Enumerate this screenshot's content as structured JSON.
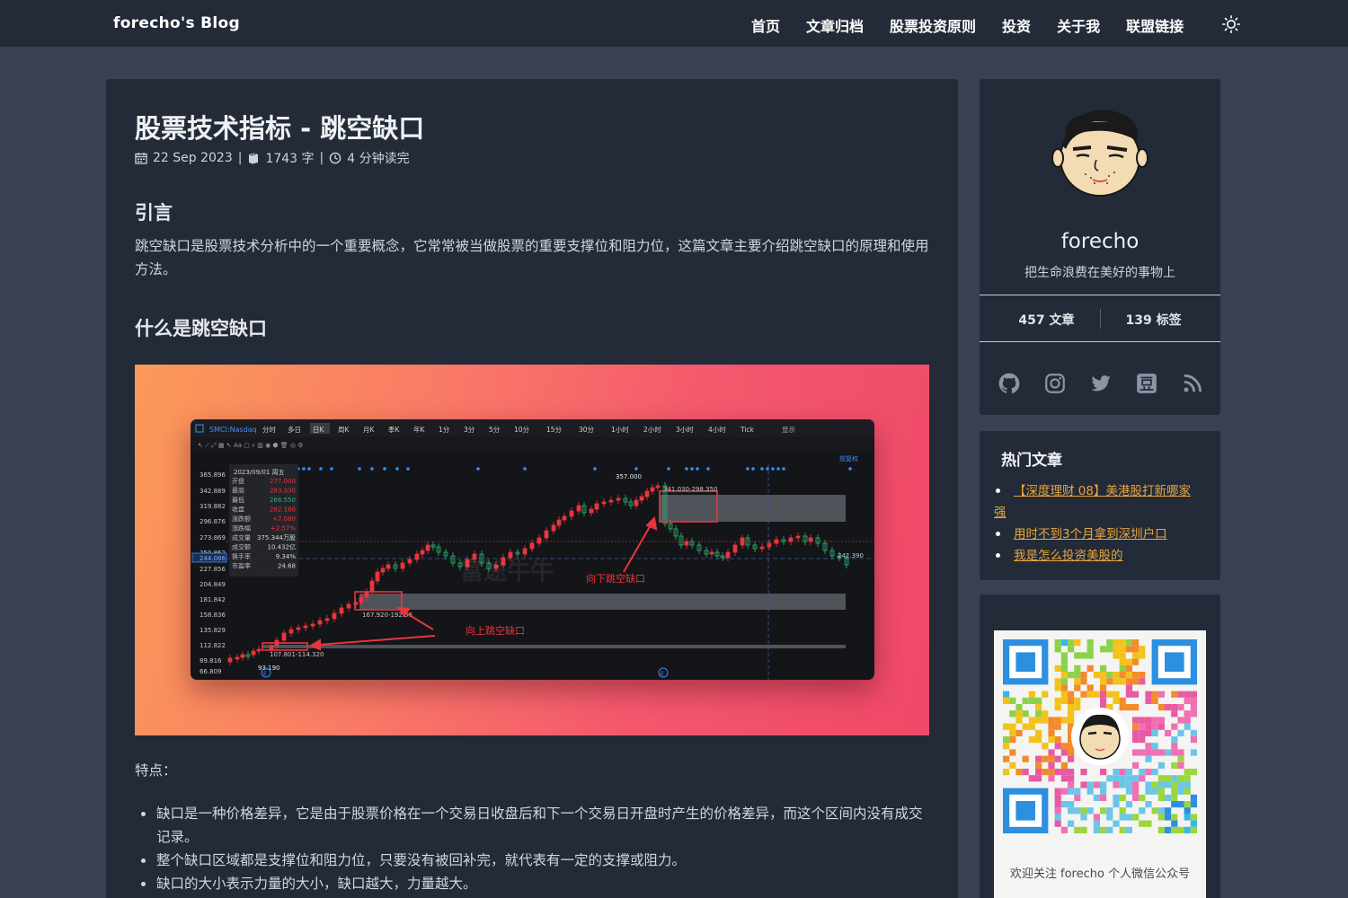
{
  "site": {
    "brand": "forecho's Blog",
    "nav": [
      "首页",
      "文章归档",
      "股票投资原则",
      "投资",
      "关于我",
      "联盟链接"
    ]
  },
  "article": {
    "title": "股票技术指标 - 跳空缺口",
    "date": "22 Sep 2023",
    "word_count": "1743 字",
    "read_time": "4 分钟读完",
    "section1_title": "引言",
    "section1_text": "跳空缺口是股票技术分析中的一个重要概念，它常常被当做股票的重要支撑位和阻力位，这篇文章主要介绍跳空缺口的原理和使用方法。",
    "section2_title": "什么是跳空缺口",
    "features_label": "特点：",
    "features": [
      "缺口是一种价格差异，它是由于股票价格在一个交易日收盘后和下一个交易日开盘时产生的价格差异，而这个区间内没有成交记录。",
      "整个缺口区域都是支撑位和阻力位，只要没有被回补完，就代表有一定的支撑或阻力。",
      "缺口的大小表示力量的大小，缺口越大，力量越大。"
    ]
  },
  "figure": {
    "symbol": "SMCI:Nasdaq",
    "periods": [
      "分时",
      "多日",
      "日K",
      "周K",
      "月K",
      "季K",
      "年K",
      "1分",
      "3分",
      "5分",
      "10分",
      "15分",
      "30分",
      "1小时",
      "2小时",
      "3小时",
      "4小时",
      "Tick"
    ],
    "active_period": "日K",
    "display_label": "显示",
    "adjust_label": "前复权",
    "price_axis": [
      "365.896",
      "342.889",
      "319.882",
      "296.876",
      "273.869",
      "250.862",
      "244.086",
      "227.856",
      "204.849",
      "181.842",
      "158.836",
      "135.829",
      "112.822",
      "89.816",
      "66.809"
    ],
    "info_panel": {
      "date": "2023/09/01 周五",
      "rows": [
        {
          "k": "开盘",
          "v": "277.000"
        },
        {
          "k": "最高",
          "v": "283.330"
        },
        {
          "k": "最低",
          "v": "266.550"
        },
        {
          "k": "收盘",
          "v": "282.160"
        },
        {
          "k": "涨跌额",
          "v": "+7.080"
        },
        {
          "k": "涨跌幅",
          "v": "+2.57%"
        },
        {
          "k": "成交量",
          "v": "375.344万股"
        },
        {
          "k": "成交额",
          "v": "10.432亿"
        },
        {
          "k": "换手率",
          "v": "9.34%"
        },
        {
          "k": "市盈率",
          "v": "24.68"
        }
      ]
    },
    "high_label": "357.000",
    "low_label": "93.190",
    "right_price": "242.390",
    "gap_down_range": "341.030-298.350",
    "gap_up_range_1": "167.920-192.56",
    "gap_up_range_2": "107.801-114.320",
    "annotation_down": "向下跳空缺口",
    "annotation_up": "向上跳空缺口",
    "watermark": "富途牛牛"
  },
  "sidebar": {
    "name": "forecho",
    "motto": "把生命浪费在美好的事物上",
    "posts": "457 文章",
    "tags": "139 标签",
    "social_icons": [
      "github-icon",
      "instagram-icon",
      "twitter-icon",
      "douban-icon",
      "rss-icon"
    ],
    "hot_title": "热门文章",
    "hot_posts": [
      "【深度理财 08】美港股打新哪家强",
      "用时不到3个月拿到深圳户口",
      "我是怎么投资美股的"
    ],
    "qr_caption": "欢迎关注 forecho 个人微信公众号"
  },
  "colors": {
    "background": "#3a4152",
    "card": "#232a38",
    "link": "#e8a73a",
    "up": "#e8363c",
    "down": "#2bb673"
  }
}
